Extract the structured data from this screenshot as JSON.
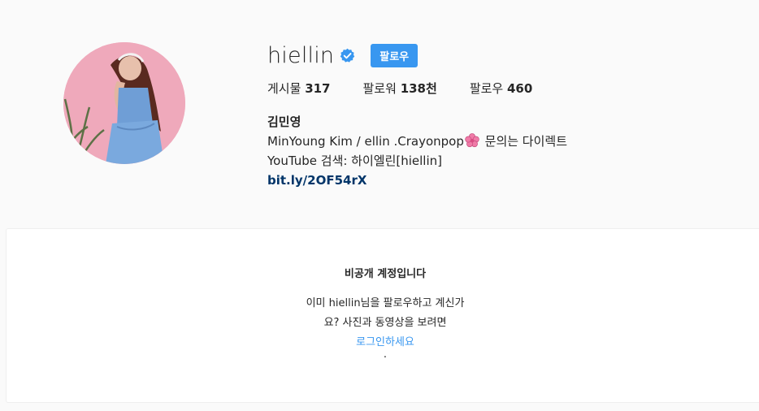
{
  "profile": {
    "username": "hiellin",
    "verified": true,
    "follow_label": "팔로우",
    "stats": {
      "posts_label": "게시물",
      "posts_value": "317",
      "followers_label": "팔로워",
      "followers_value": "138천",
      "following_label": "팔로우",
      "following_value": "460"
    },
    "full_name": "김민영",
    "bio_line1_text": "MinYoung Kim / ellin .Crayonpop",
    "bio_line1_suffix": " 문의는 다이렉트",
    "bio_line2": "YouTube 검색: 하이엘린[hiellin]",
    "bio_link": "bit.ly/2OF54rX"
  },
  "private_notice": {
    "title": "비공개 계정입니다",
    "message_line1": "이미 hiellin님을 팔로우하고 계신가",
    "message_line2": "요? 사진과 동영상을 보려면",
    "login_link": "로그인하세요",
    "trailing": "."
  },
  "colors": {
    "accent": "#3897f0",
    "link": "#003569",
    "background": "#fafafa",
    "text": "#262626"
  },
  "icons": {
    "verified": "verified-badge-icon",
    "flower": "cherry-blossom-emoji"
  }
}
